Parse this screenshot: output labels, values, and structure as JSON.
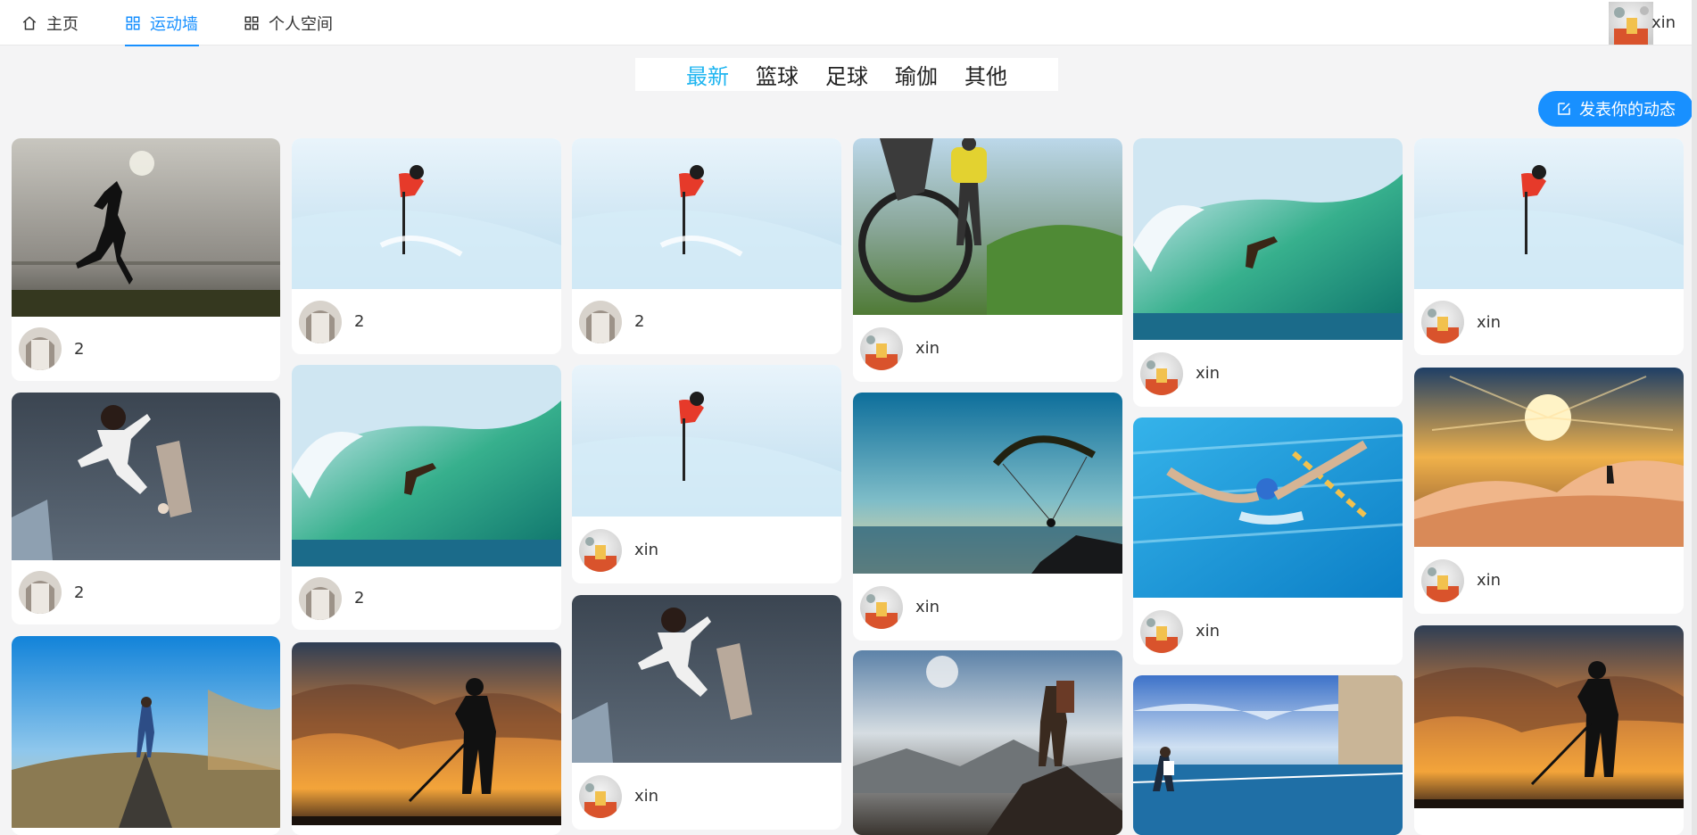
{
  "nav": {
    "home_label": "主页",
    "wall_label": "运动墙",
    "space_label": "个人空间",
    "user_name": "xin"
  },
  "categories": [
    "最新",
    "篮球",
    "足球",
    "瑜伽",
    "其他"
  ],
  "active_category": "最新",
  "publish_label": "发表你的动态",
  "colors": {
    "accent": "#1890ff",
    "active_tab": "#1fb5f0",
    "background": "#f4f4f5"
  },
  "posts": [
    {
      "author": "2",
      "image": "runner-silhouette"
    },
    {
      "author": "2",
      "image": "skateboard-jump"
    },
    {
      "author": "",
      "image": "road-walker"
    },
    {
      "author": "2",
      "image": "skier-powder"
    },
    {
      "author": "2",
      "image": "surf-wave"
    },
    {
      "author": "",
      "image": "golfer-sunset"
    },
    {
      "author": "2",
      "image": "skier-powder"
    },
    {
      "author": "xin",
      "image": "skier-powder"
    },
    {
      "author": "xin",
      "image": "skateboard-jump"
    },
    {
      "author": "xin",
      "image": "mountain-bike"
    },
    {
      "author": "xin",
      "image": "paraglider"
    },
    {
      "author": "",
      "image": "hiker-cliff"
    },
    {
      "author": "xin",
      "image": "surf-wave"
    },
    {
      "author": "xin",
      "image": "butterfly-swimmer"
    },
    {
      "author": "",
      "image": "tennis-court"
    },
    {
      "author": "xin",
      "image": "skier-powder"
    },
    {
      "author": "xin",
      "image": "sunrise-ridge"
    },
    {
      "author": "",
      "image": "golfer-sunset"
    }
  ]
}
